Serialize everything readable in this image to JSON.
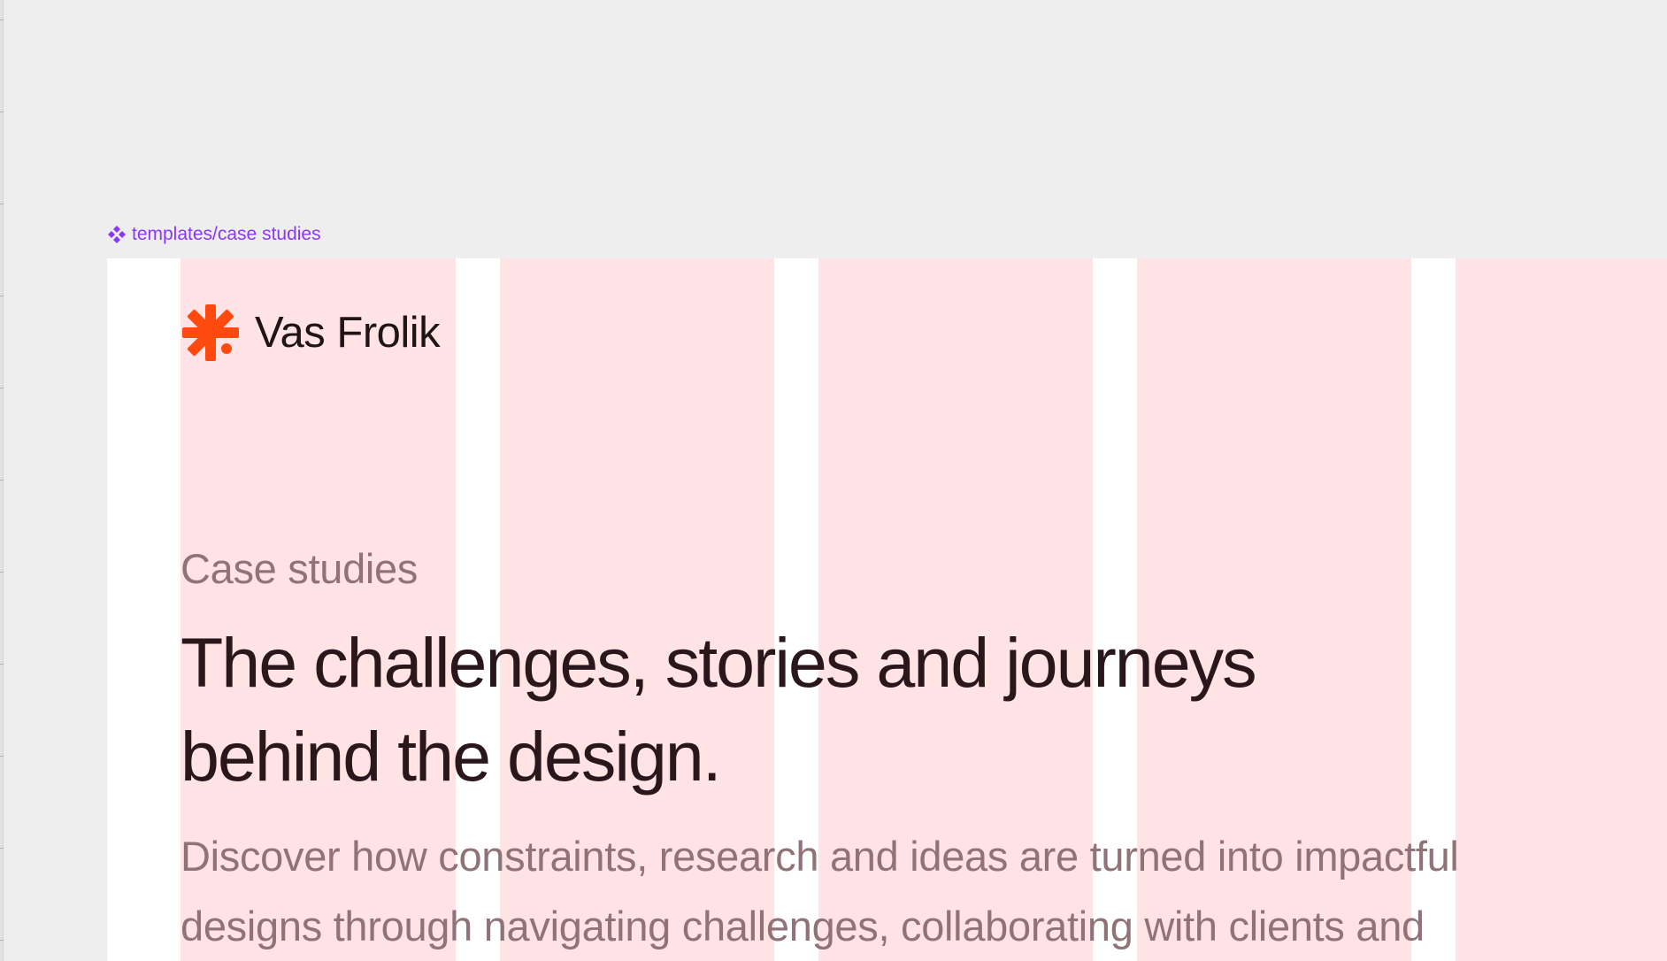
{
  "frame_label": {
    "icon": "component-icon",
    "text": "templates/case studies",
    "color": "#8a38f5"
  },
  "brand": {
    "logo_icon": "asterisk-logo-icon",
    "name": "Vas Frolik",
    "accent_color": "#ff4a0f"
  },
  "hero": {
    "eyebrow": "Case studies",
    "headline_line1": "The challenges, stories and journeys",
    "headline_line2": "behind the design.",
    "lede_line1": "Discover how constraints, research and ideas are turned into impactful",
    "lede_line2": "designs through navigating challenges, collaborating with clients and"
  },
  "colors": {
    "canvas": "#eeeeee",
    "frame": "#ffffff",
    "grid_column": "#ffe3e5",
    "heading": "#2a171b",
    "muted_text": "#8f7378"
  }
}
